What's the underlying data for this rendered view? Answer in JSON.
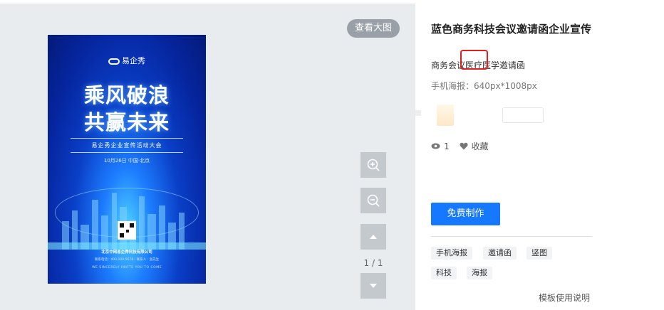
{
  "preview": {
    "view_large_label": "查看大图",
    "page_indicator": "1 / 1",
    "poster": {
      "logo_text": "易企秀",
      "headline_1": "乘风破浪",
      "headline_2": "共赢未来",
      "subtitle": "易企秀企业宣传活动大会",
      "date_location": "10月26日 中国·北京",
      "company": "北京中网易企秀科技有限公司",
      "contact": "联系电话：400-100-5678 / 联系人：张先生",
      "invite": "WE SINCERELY INVITE YOU TO COME"
    },
    "tools": {
      "zoom_in_icon": "zoom-in-icon",
      "zoom_out_icon": "zoom-out-icon",
      "prev_icon": "triangle-up-icon",
      "next_icon": "triangle-down-icon"
    }
  },
  "detail": {
    "title": "蓝色商务科技会议邀请函企业宣传",
    "description": "商务会议医疗医学邀请函",
    "spec": "手机海报：640px*1008px",
    "views": "1",
    "favorite_label": "收藏",
    "cta_label": "免费制作",
    "tags": [
      "手机海报",
      "邀请函",
      "竖图",
      "科技",
      "海报"
    ],
    "guide_link": "模板使用说明"
  },
  "colors": {
    "accent": "#1677ff",
    "preview_bg": "#e9ecef",
    "highlight": "#e02020"
  }
}
